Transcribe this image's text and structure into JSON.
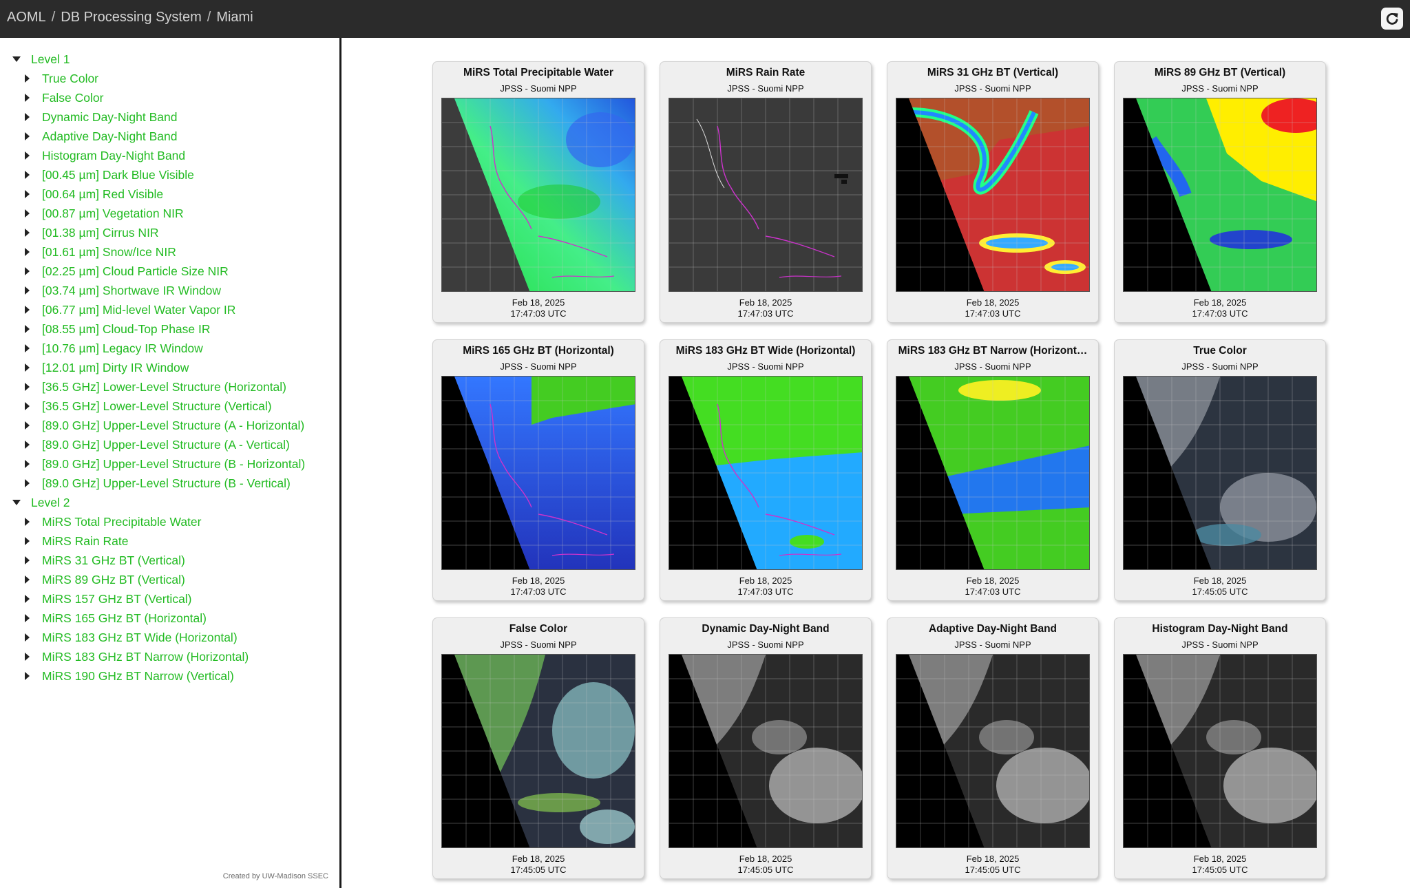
{
  "header": {
    "crumbs": [
      "AOML",
      "DB Processing System",
      "Miami"
    ],
    "refresh_icon": "refresh-icon"
  },
  "sidebar": {
    "groups": [
      {
        "label": "Level 1",
        "items": [
          "True Color",
          "False Color",
          "Dynamic Day-Night Band",
          "Adaptive Day-Night Band",
          "Histogram Day-Night Band",
          "[00.45 µm] Dark Blue Visible",
          "[00.64 µm] Red Visible",
          "[00.87 µm] Vegetation NIR",
          "[01.38 µm] Cirrus NIR",
          "[01.61 µm] Snow/Ice NIR",
          "[02.25 µm] Cloud Particle Size NIR",
          "[03.74 µm] Shortwave IR Window",
          "[06.77 µm] Mid-level Water Vapor IR",
          "[08.55 µm] Cloud-Top Phase IR",
          "[10.76 µm] Legacy IR Window",
          "[12.01 µm] Dirty IR Window",
          "[36.5 GHz] Lower-Level Structure (Horizontal)",
          "[36.5 GHz] Lower-Level Structure (Vertical)",
          "[89.0 GHz] Upper-Level Structure (A - Horizontal)",
          "[89.0 GHz] Upper-Level Structure (A - Vertical)",
          "[89.0 GHz] Upper-Level Structure (B - Horizontal)",
          "[89.0 GHz] Upper-Level Structure (B - Vertical)"
        ]
      },
      {
        "label": "Level 2",
        "items": [
          "MiRS Total Precipitable Water",
          "MiRS Rain Rate",
          "MiRS 31 GHz BT (Vertical)",
          "MiRS 89 GHz BT (Vertical)",
          "MiRS 157 GHz BT (Vertical)",
          "MiRS 165 GHz BT (Horizontal)",
          "MiRS 183 GHz BT Wide (Horizontal)",
          "MiRS 183 GHz BT Narrow (Horizontal)",
          "MiRS 190 GHz BT Narrow (Vertical)"
        ]
      }
    ],
    "credit": "Created by UW-Madison SSEC",
    "colors": {
      "link": "#22bb22"
    }
  },
  "cards": [
    {
      "title": "MiRS Total Precipitable Water",
      "subtitle": "JPSS - Suomi NPP",
      "date": "Feb 18, 2025",
      "time": "17:47:03 UTC",
      "style": "tpw"
    },
    {
      "title": "MiRS Rain Rate",
      "subtitle": "JPSS - Suomi NPP",
      "date": "Feb 18, 2025",
      "time": "17:47:03 UTC",
      "style": "rain"
    },
    {
      "title": "MiRS 31 GHz BT (Vertical)",
      "subtitle": "JPSS - Suomi NPP",
      "date": "Feb 18, 2025",
      "time": "17:47:03 UTC",
      "style": "bt31"
    },
    {
      "title": "MiRS 89 GHz BT (Vertical)",
      "subtitle": "JPSS - Suomi NPP",
      "date": "Feb 18, 2025",
      "time": "17:47:03 UTC",
      "style": "bt89"
    },
    {
      "title": "MiRS 165 GHz BT (Horizontal)",
      "subtitle": "JPSS - Suomi NPP",
      "date": "Feb 18, 2025",
      "time": "17:47:03 UTC",
      "style": "bt165"
    },
    {
      "title": "MiRS 183 GHz BT Wide (Horizontal)",
      "subtitle": "JPSS - Suomi NPP",
      "date": "Feb 18, 2025",
      "time": "17:47:03 UTC",
      "style": "bt183w"
    },
    {
      "title": "MiRS 183 GHz BT Narrow (Horizont…",
      "subtitle": "JPSS - Suomi NPP",
      "date": "Feb 18, 2025",
      "time": "17:47:03 UTC",
      "style": "bt183n"
    },
    {
      "title": "True Color",
      "subtitle": "JPSS - Suomi NPP",
      "date": "Feb 18, 2025",
      "time": "17:45:05 UTC",
      "style": "truecolor"
    },
    {
      "title": "False Color",
      "subtitle": "JPSS - Suomi NPP",
      "date": "Feb 18, 2025",
      "time": "17:45:05 UTC",
      "style": "falsecolor"
    },
    {
      "title": "Dynamic Day-Night Band",
      "subtitle": "JPSS - Suomi NPP",
      "date": "Feb 18, 2025",
      "time": "17:45:05 UTC",
      "style": "dnb"
    },
    {
      "title": "Adaptive Day-Night Band",
      "subtitle": "JPSS - Suomi NPP",
      "date": "Feb 18, 2025",
      "time": "17:45:05 UTC",
      "style": "dnb"
    },
    {
      "title": "Histogram Day-Night Band",
      "subtitle": "JPSS - Suomi NPP",
      "date": "Feb 18, 2025",
      "time": "17:45:05 UTC",
      "style": "dnb"
    }
  ]
}
